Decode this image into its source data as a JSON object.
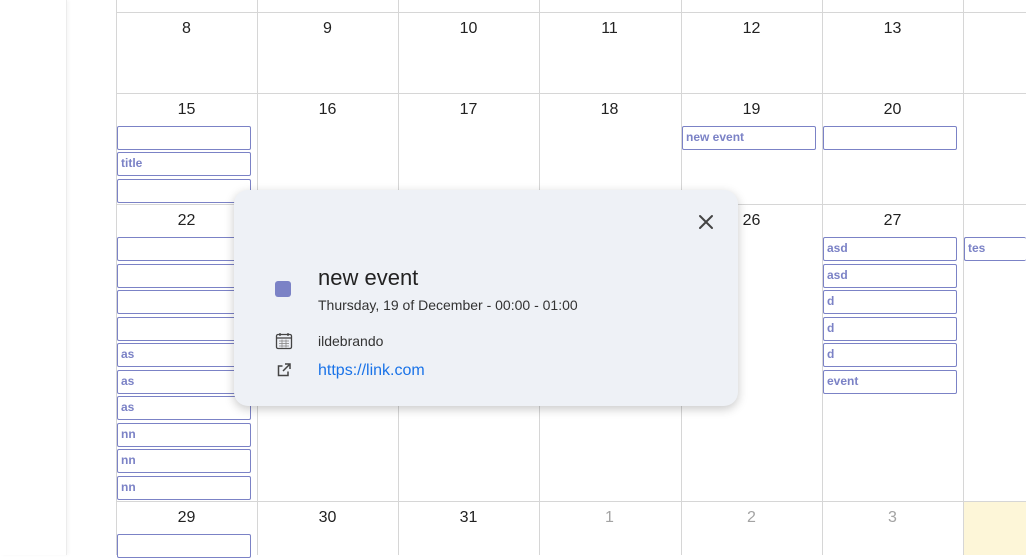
{
  "calendar": {
    "week2": [
      "8",
      "9",
      "10",
      "11",
      "12",
      "13"
    ],
    "week3": [
      "15",
      "16",
      "17",
      "18",
      "19",
      "20"
    ],
    "week4": [
      "22",
      "26",
      "27"
    ],
    "week5": [
      "29",
      "30",
      "31",
      "1",
      "2",
      "3"
    ],
    "today_color": "#fdf6d8",
    "event_color": "#7b82c6"
  },
  "events": {
    "d15": [
      "",
      "title",
      ""
    ],
    "d19": "new event",
    "d20": "",
    "d22": [
      "",
      "",
      "",
      "",
      "as",
      "as",
      "as",
      "nn",
      "nn",
      "nn"
    ],
    "d27": [
      "asd",
      "asd",
      "d",
      "d",
      "d",
      "event"
    ],
    "d28": "tes",
    "d29": ""
  },
  "popup": {
    "title": "new event",
    "datetime": "Thursday, 19 of December - 00:00 - 01:00",
    "calendar_name": "ildebrando",
    "link": "https://link.com",
    "color": "#7b82c6",
    "icons": {
      "close": "close-icon",
      "calendar": "calendar-icon",
      "link": "external-link-icon"
    }
  }
}
